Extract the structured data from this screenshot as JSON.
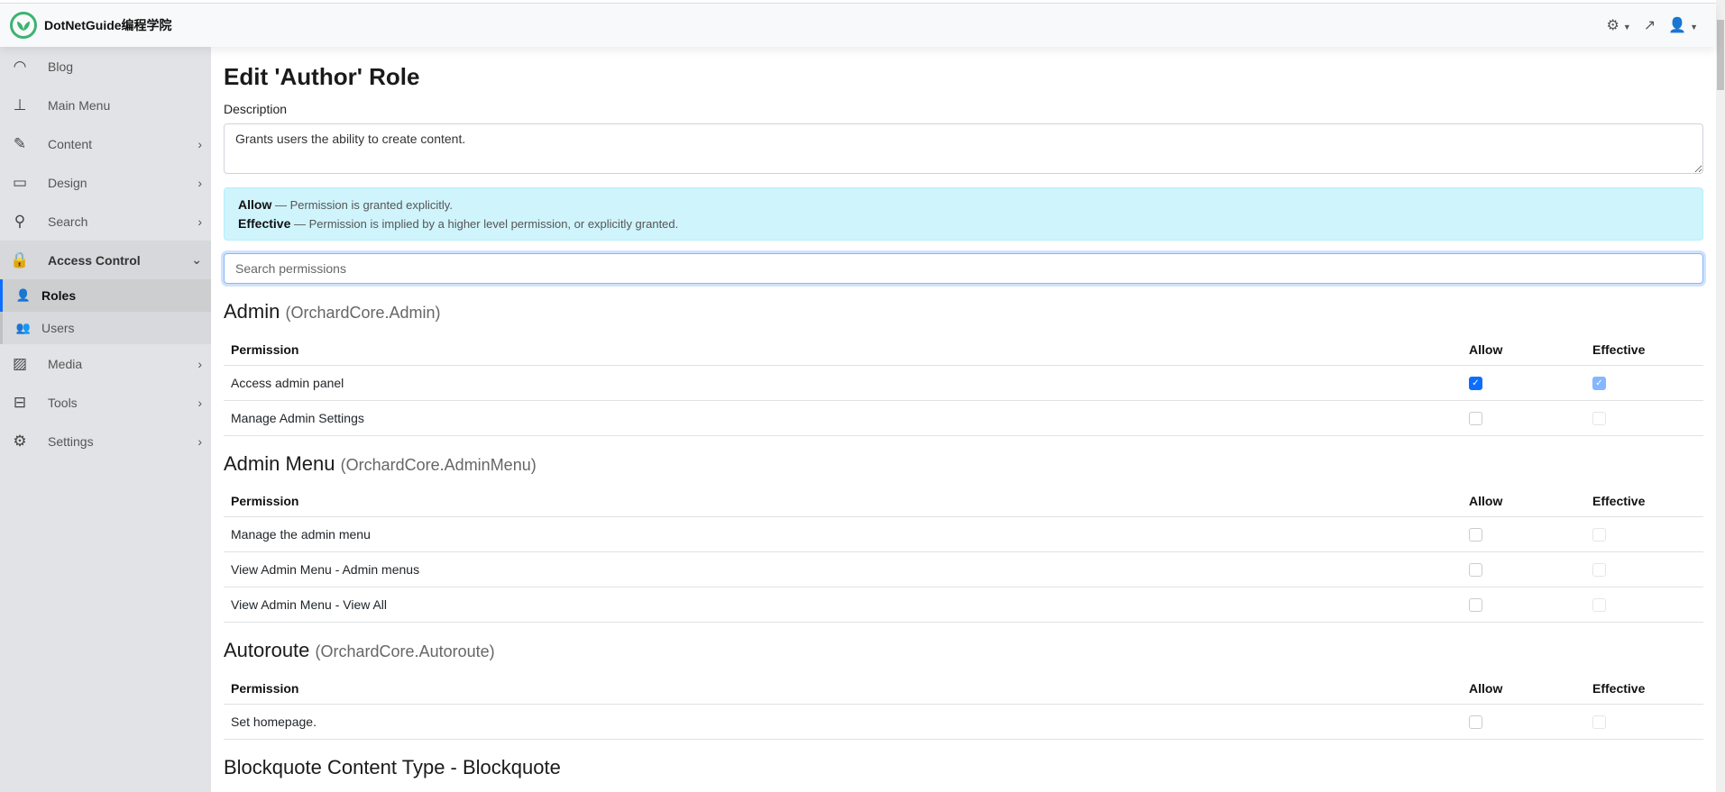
{
  "header": {
    "brand": "DotNetGuide编程学院"
  },
  "sidebar": {
    "items": [
      {
        "label": "Blog",
        "icon": "rss-icon"
      },
      {
        "label": "Main Menu",
        "icon": "sitemap-icon"
      },
      {
        "label": "Content",
        "icon": "edit-icon"
      },
      {
        "label": "Design",
        "icon": "desktop-icon"
      },
      {
        "label": "Search",
        "icon": "search-icon"
      },
      {
        "label": "Access Control",
        "icon": "lock-icon"
      },
      {
        "label": "Roles",
        "icon": "user-lock-icon"
      },
      {
        "label": "Users",
        "icon": "users-icon"
      },
      {
        "label": "Media",
        "icon": "images-icon"
      },
      {
        "label": "Tools",
        "icon": "toolbox-icon"
      },
      {
        "label": "Settings",
        "icon": "gear-icon"
      }
    ]
  },
  "main": {
    "title": "Edit 'Author' Role",
    "description_label": "Description",
    "description": "Grants users the ability to create content.",
    "info": {
      "allow_term": "Allow",
      "allow_text": " — Permission is granted explicitly.",
      "effective_term": "Effective",
      "effective_text": " — Permission is implied by a higher level permission, or explicitly granted."
    },
    "search_placeholder": "Search permissions",
    "columns": {
      "permission": "Permission",
      "allow": "Allow",
      "effective": "Effective"
    },
    "groups": [
      {
        "name": "Admin",
        "module": "(OrchardCore.Admin)",
        "rows": [
          {
            "name": "Access admin panel",
            "allow": true,
            "effective": true
          },
          {
            "name": "Manage Admin Settings",
            "allow": false,
            "effective": false
          }
        ]
      },
      {
        "name": "Admin Menu",
        "module": "(OrchardCore.AdminMenu)",
        "rows": [
          {
            "name": "Manage the admin menu",
            "allow": false,
            "effective": false
          },
          {
            "name": "View Admin Menu - Admin menus",
            "allow": false,
            "effective": false
          },
          {
            "name": "View Admin Menu - View All",
            "allow": false,
            "effective": false
          }
        ]
      },
      {
        "name": "Autoroute",
        "module": "(OrchardCore.Autoroute)",
        "rows": [
          {
            "name": "Set homepage.",
            "allow": false,
            "effective": false
          }
        ]
      },
      {
        "name": "Blockquote Content Type - Blockquote",
        "module": "",
        "rows": []
      }
    ]
  }
}
